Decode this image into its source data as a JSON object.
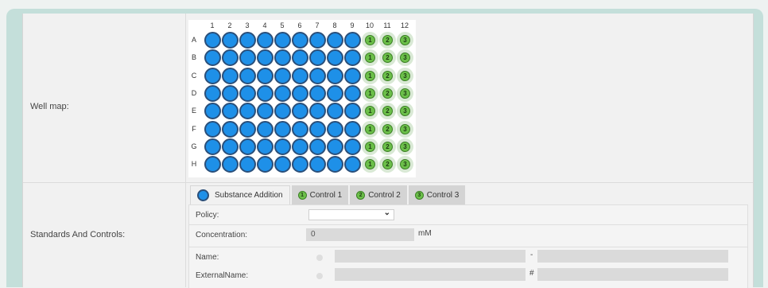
{
  "well_map": {
    "label": "Well map:",
    "columns": [
      "1",
      "2",
      "3",
      "4",
      "5",
      "6",
      "7",
      "8",
      "9",
      "10",
      "11",
      "12"
    ],
    "rows": [
      "A",
      "B",
      "C",
      "D",
      "E",
      "F",
      "G",
      "H"
    ],
    "substance_columns": 9,
    "control_labels": [
      "1",
      "2",
      "3"
    ],
    "colors": {
      "substance_fill": "#1e90e8",
      "substance_ring": "#2a4f7a",
      "control_fill": "#6cc04a",
      "control_bg": "#d9e9d5"
    }
  },
  "standards": {
    "label": "Standards And Controls:",
    "tabs": [
      {
        "label": "Substance Addition",
        "kind": "substance",
        "active": true
      },
      {
        "label": "Control 1",
        "kind": "control",
        "badge": "1",
        "active": false
      },
      {
        "label": "Control 2",
        "kind": "control",
        "badge": "2",
        "active": false
      },
      {
        "label": "Control 3",
        "kind": "control",
        "badge": "3",
        "active": false
      }
    ],
    "policy": {
      "label": "Policy:",
      "value": "",
      "chevron_icon": "chevron-down-icon"
    },
    "concentration": {
      "label": "Concentration:",
      "value": "0",
      "unit": "mM"
    },
    "name": {
      "label": "Name:",
      "first": "",
      "separator": "-",
      "second": ""
    },
    "external_name": {
      "label": "ExternalName:",
      "first": "",
      "separator": "#",
      "second": ""
    }
  }
}
